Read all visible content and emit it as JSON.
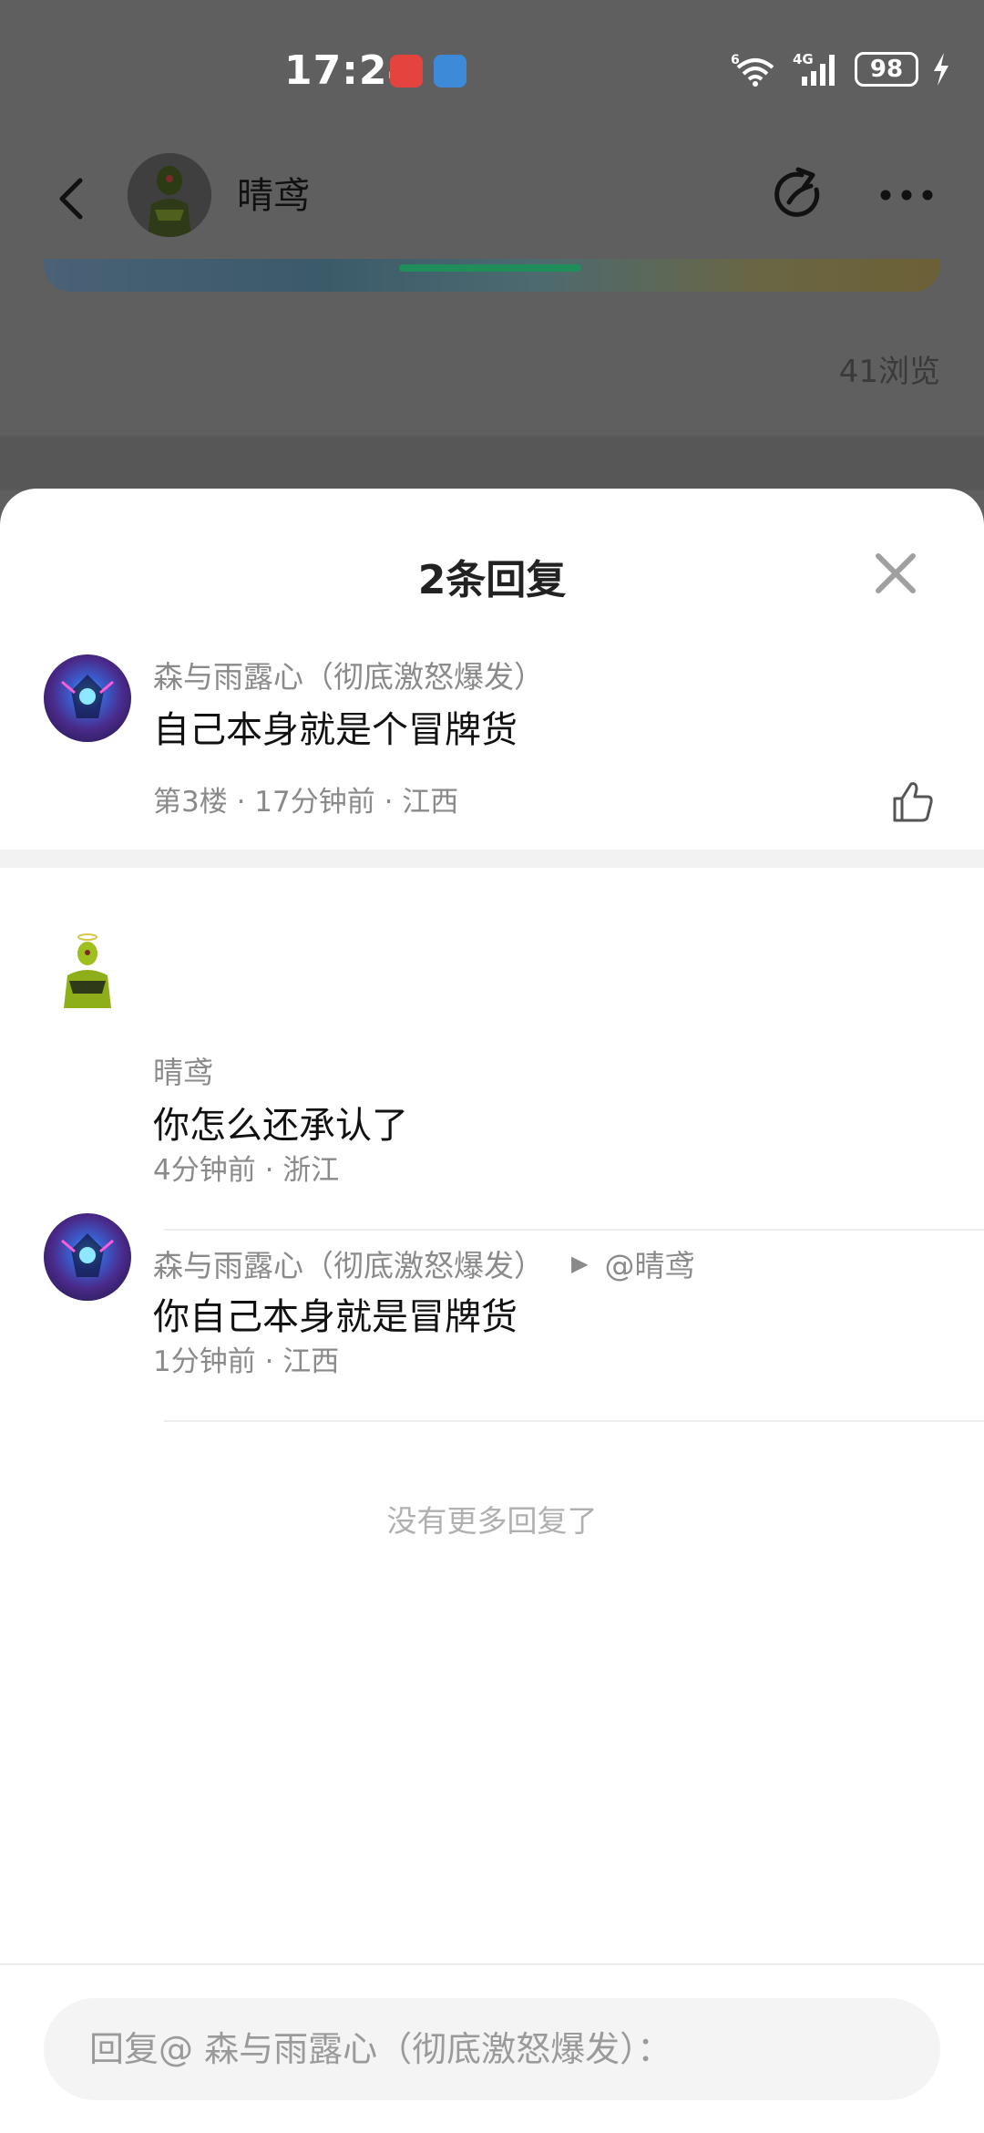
{
  "status_bar": {
    "time": "17:24",
    "network": "4G",
    "wifi_sup": "6",
    "battery": "98"
  },
  "header": {
    "name": "晴鸢",
    "views": "41浏览"
  },
  "sheet": {
    "title": "2条回复",
    "main_comment": {
      "author": "森与雨露心（彻底激怒爆发）",
      "text": "自己本身就是个冒牌货",
      "meta": "第3楼 · 17分钟前 · 江西"
    },
    "replies": [
      {
        "author": "晴鸢",
        "reply_to": "",
        "text": "你怎么还承认了",
        "meta": "4分钟前 · 浙江"
      },
      {
        "author": "森与雨露心（彻底激怒爆发）",
        "reply_to": "@晴鸢",
        "text": "你自己本身就是冒牌货",
        "meta": "1分钟前 · 江西"
      }
    ],
    "no_more": "没有更多回复了",
    "input_placeholder": "回复@ 森与雨露心（彻底激怒爆发）："
  },
  "colors": {
    "overlay": "#5f5f5f",
    "sheet_bg": "#ffffff",
    "meta_text": "#8a8a8a",
    "input_bg": "#f4f4f4"
  },
  "icons": [
    "back-arrow-icon",
    "share-icon",
    "more-icon",
    "close-icon",
    "thumbs-up-icon",
    "wifi-icon",
    "signal-icon",
    "charging-icon",
    "reply-arrow-icon"
  ]
}
